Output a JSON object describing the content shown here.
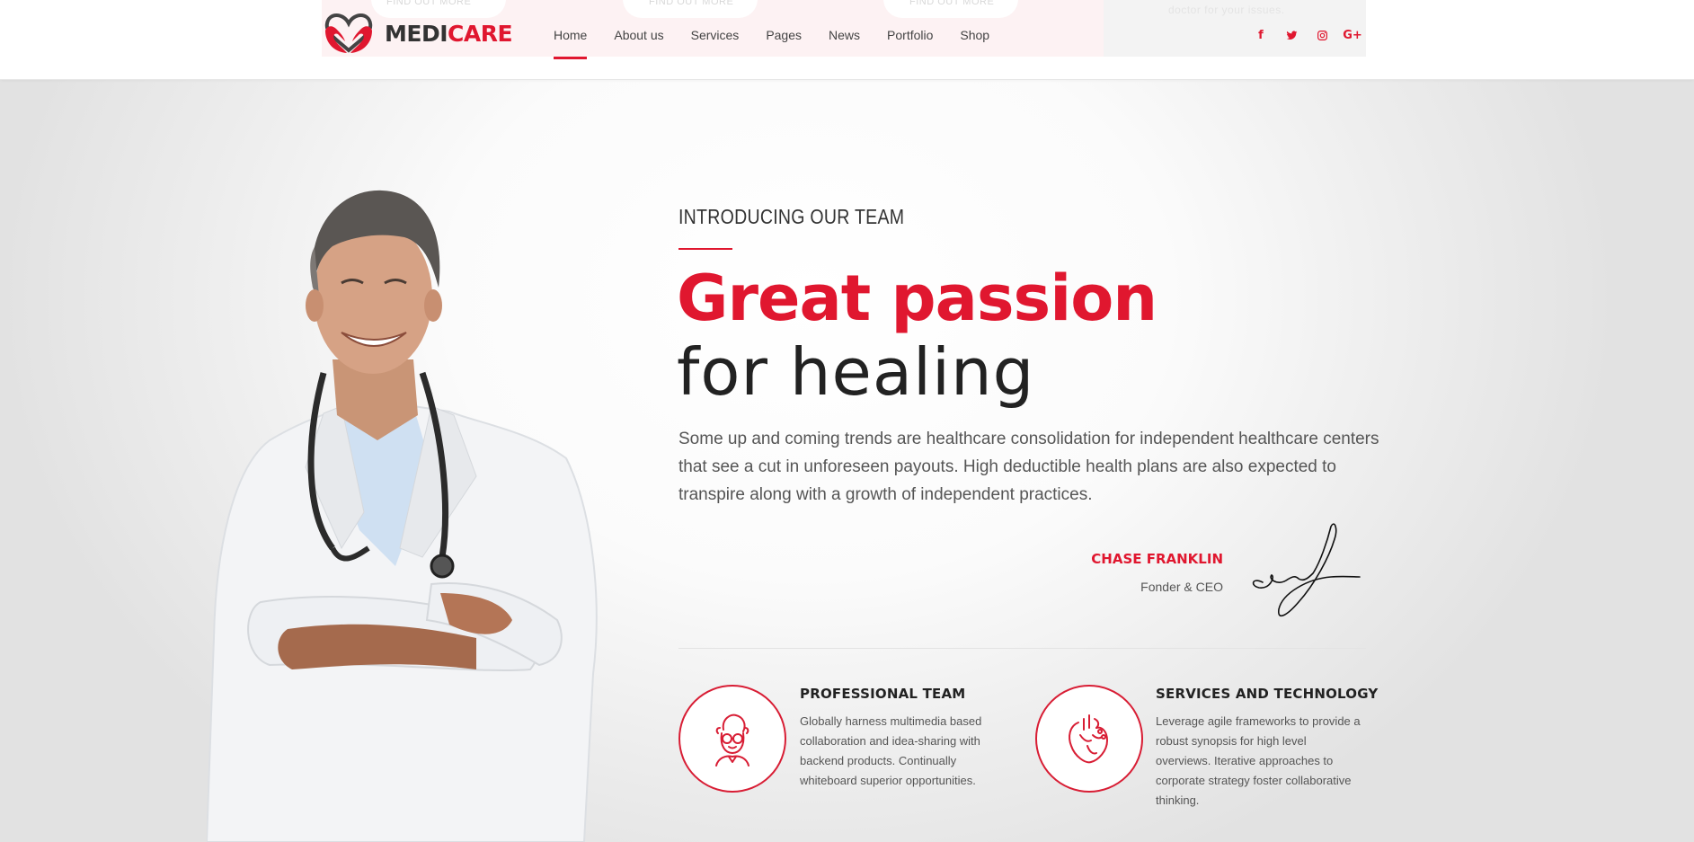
{
  "header": {
    "logo": {
      "part1": "MEDI",
      "part2": "CARE"
    },
    "nav": [
      {
        "label": "Home",
        "active": true
      },
      {
        "label": "About us",
        "active": false
      },
      {
        "label": "Services",
        "active": false
      },
      {
        "label": "Pages",
        "active": false
      },
      {
        "label": "News",
        "active": false
      },
      {
        "label": "Portfolio",
        "active": false
      },
      {
        "label": "Shop",
        "active": false
      }
    ],
    "social": [
      {
        "icon": "facebook-icon",
        "glyph": "f"
      },
      {
        "icon": "twitter-icon",
        "glyph": "t"
      },
      {
        "icon": "instagram-icon",
        "glyph": "◎"
      },
      {
        "icon": "google-plus-icon",
        "glyph": "G+"
      }
    ],
    "ghost": {
      "button_text": "FIND OUT MORE",
      "tagline": "doctor for your issues."
    }
  },
  "hero": {
    "eyebrow": "INTRODUCING OUR TEAM",
    "title_line1": "Great passion",
    "title_line2": "for healing",
    "paragraph": "Some up and coming trends are healthcare consolidation for independent healthcare centers that see a cut in unforeseen payouts. High deductible health plans are also expected to transpire along with a growth of independent practices.",
    "signature": {
      "name": "CHASE FRANKLIN",
      "role": "Fonder & CEO"
    }
  },
  "features": [
    {
      "icon": "doctor-avatar-icon",
      "title": "PROFESSIONAL TEAM",
      "text": "Globally harness multimedia based collaboration and idea-sharing with backend products. Continually whiteboard superior opportunities."
    },
    {
      "icon": "heart-organ-icon",
      "title": "SERVICES AND TECHNOLOGY",
      "text": "Leverage agile frameworks to provide a robust synopsis for high level overviews. Iterative approaches to corporate strategy foster collaborative thinking."
    }
  ],
  "colors": {
    "accent": "#e0172f",
    "text": "#222222",
    "muted": "#555555"
  }
}
